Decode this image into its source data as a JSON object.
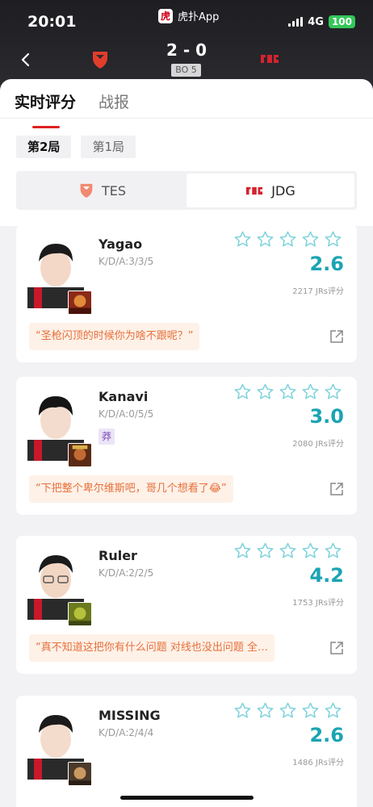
{
  "status_bar": {
    "time": "20:01",
    "app_label": "虎扑App",
    "app_logo_char": "虎",
    "network": "4G",
    "battery": "100"
  },
  "match": {
    "score": "2 - 0",
    "format": "BO 5",
    "team_left": "TES",
    "team_right": "JDG"
  },
  "tabs": [
    {
      "label": "实时评分",
      "active": true
    },
    {
      "label": "战报",
      "active": false
    }
  ],
  "games": [
    {
      "label": "第2局",
      "active": true
    },
    {
      "label": "第1局",
      "active": false
    }
  ],
  "team_switch": [
    {
      "label": "TES",
      "active": false
    },
    {
      "label": "JDG",
      "active": true
    }
  ],
  "colors": {
    "accent_red": "#e02020",
    "rating_teal": "#1ba4b3",
    "comment_orange": "#e8703a"
  },
  "players": [
    {
      "name": "Yagao",
      "kda": "K/D/A:3/3/5",
      "rating": "2.6",
      "votes": "2217 JRs评分",
      "comment": "“圣枪闪顶的时候你为啥不跟呢？”",
      "badge": ""
    },
    {
      "name": "Kanavi",
      "kda": "K/D/A:0/5/5",
      "rating": "3.0",
      "votes": "2080 JRs评分",
      "comment": "“下把整个卑尔维斯吧，哥几个想看了😂”",
      "badge": "莽"
    },
    {
      "name": "Ruler",
      "kda": "K/D/A:2/2/5",
      "rating": "4.2",
      "votes": "1753 JRs评分",
      "comment": "“真不知道这把你有什么问题 对线也没出问题 全…",
      "badge": ""
    },
    {
      "name": "MISSING",
      "kda": "K/D/A:2/4/4",
      "rating": "2.6",
      "votes": "1486 JRs评分",
      "comment": "",
      "badge": ""
    }
  ]
}
